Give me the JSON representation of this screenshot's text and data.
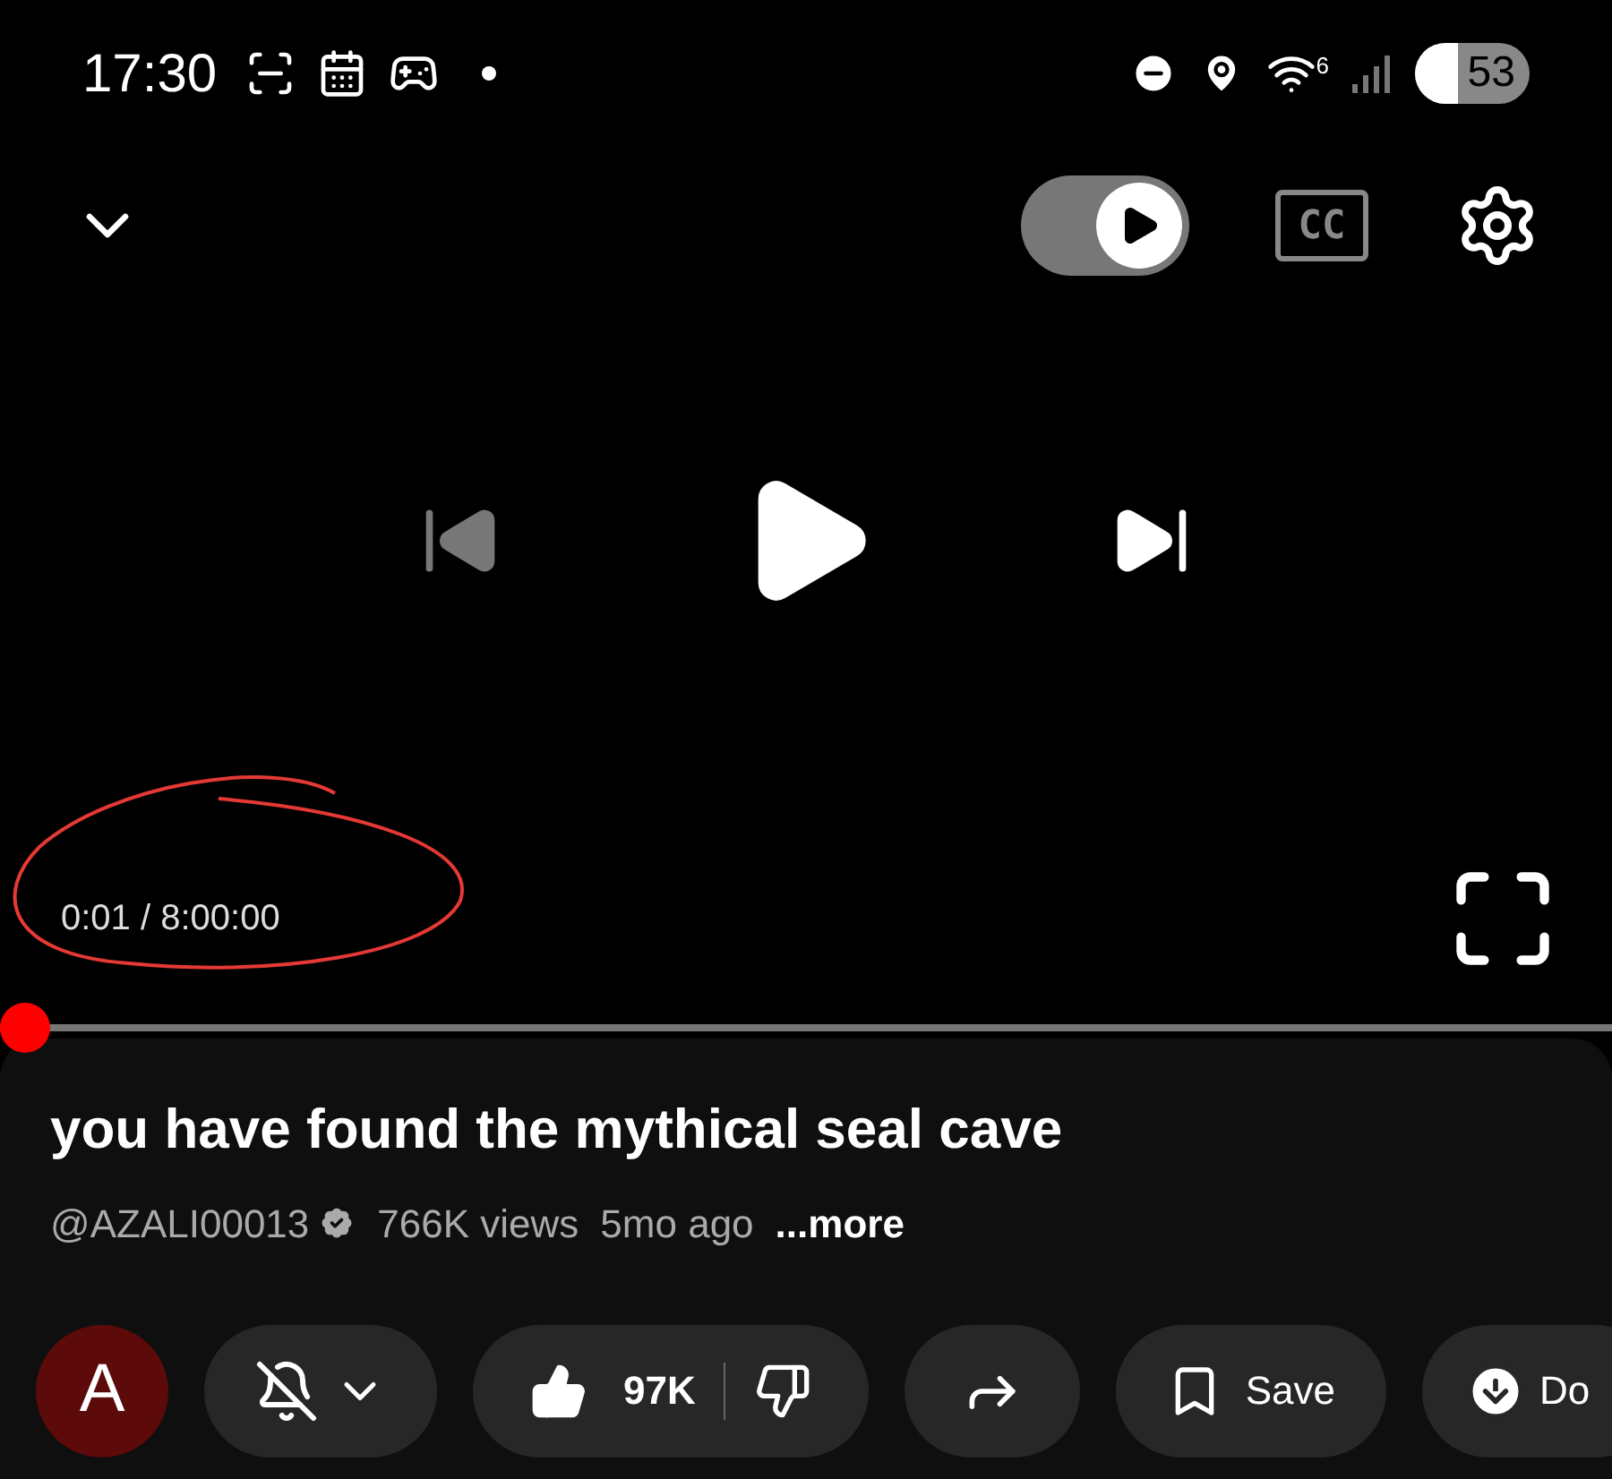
{
  "status_bar": {
    "time": "17:30",
    "wifi_badge": "6",
    "battery": "53"
  },
  "player": {
    "autoplay_on": true,
    "captions": "CC",
    "playing": false,
    "time": "0:01 / 8:00:00",
    "level": 0.0
  },
  "video": {
    "title": "you have found the mythical seal cave",
    "channel": "@AZALI00013",
    "views": "766K views",
    "age": "5mo ago",
    "more": "...more"
  },
  "actions": [
    {
      "kind": "avatar",
      "label": "A"
    },
    {
      "kind": "bell"
    },
    {
      "kind": "like",
      "label": "97K",
      "liked": true
    },
    {
      "kind": "share"
    },
    {
      "kind": "save",
      "label": "Save"
    },
    {
      "kind": "download",
      "label": "Do"
    }
  ]
}
